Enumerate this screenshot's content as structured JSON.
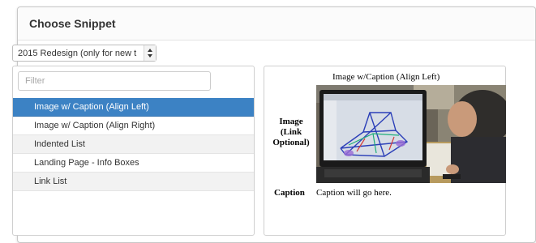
{
  "modal": {
    "title": "Choose Snippet"
  },
  "select": {
    "value": "2015 Redesign (only for new t"
  },
  "filter": {
    "placeholder": "Filter",
    "value": ""
  },
  "snippets": [
    {
      "label": "Image w/ Caption (Align Left)",
      "state": "active"
    },
    {
      "label": "Image w/ Caption (Align Right)",
      "state": "normal"
    },
    {
      "label": "Indented List",
      "state": "alt"
    },
    {
      "label": "Landing Page - Info Boxes",
      "state": "normal"
    },
    {
      "label": "Link List",
      "state": "alt"
    }
  ],
  "preview": {
    "title": "Image w/Caption (Align Left)",
    "image_label": [
      "Image",
      "(Link",
      "Optional)"
    ],
    "caption_label": "Caption",
    "caption_text": "Caption will go here."
  },
  "colors": {
    "accent": "#3c82c4",
    "border": "#cfcfcf",
    "alt_row": "#f2f2f2"
  },
  "icons": {
    "select_arrows": "up-down-arrows-icon"
  }
}
